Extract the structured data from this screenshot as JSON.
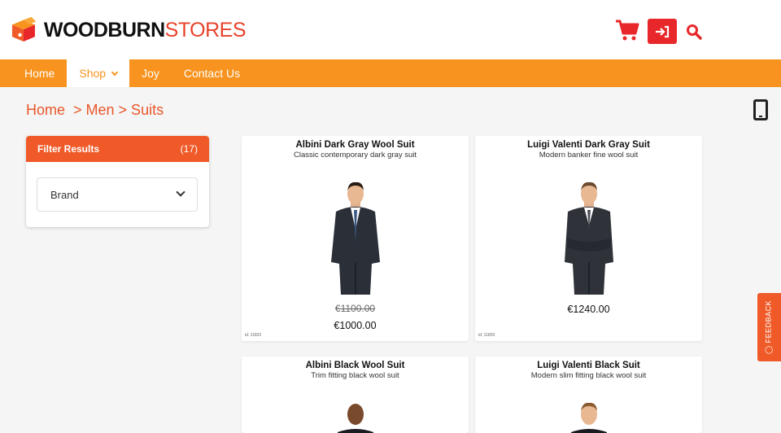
{
  "header": {
    "logo_bold": "WOODBURN",
    "logo_light": "STORES",
    "cart_icon": "cart-icon",
    "login_icon": "login-icon",
    "search_icon": "search-icon",
    "colors": {
      "brand_orange": "#f7931e",
      "accent_red": "#e8272a",
      "filter_orange": "#f05a28"
    }
  },
  "nav": {
    "items": [
      {
        "label": "Home"
      },
      {
        "label": "Shop"
      },
      {
        "label": "Joy"
      },
      {
        "label": "Contact Us"
      }
    ]
  },
  "breadcrumb": "Home  > Men > Suits",
  "filter": {
    "title": "Filter Results",
    "count": "(17)",
    "brand_label": "Brand"
  },
  "products": [
    {
      "title": "Albini Dark Gray Wool Suit",
      "subtitle": "Classic contemporary dark gray suit",
      "old_price": "€1100.00",
      "price": "€1000.00",
      "id": "id: 11822"
    },
    {
      "title": "Luigi Valenti Dark Gray Suit",
      "subtitle": "Modern banker fine wool suit",
      "old_price": "",
      "price": "€1240.00",
      "id": "id: 11829"
    },
    {
      "title": "Albini Black Wool Suit",
      "subtitle": "Trim fitting black wool suit",
      "old_price": "",
      "price": "",
      "id": ""
    },
    {
      "title": "Luigi Valenti Black Suit",
      "subtitle": "Modern slim fitting black wool suit",
      "old_price": "",
      "price": "",
      "id": ""
    }
  ],
  "feedback": {
    "label": "FEEDBACK"
  }
}
